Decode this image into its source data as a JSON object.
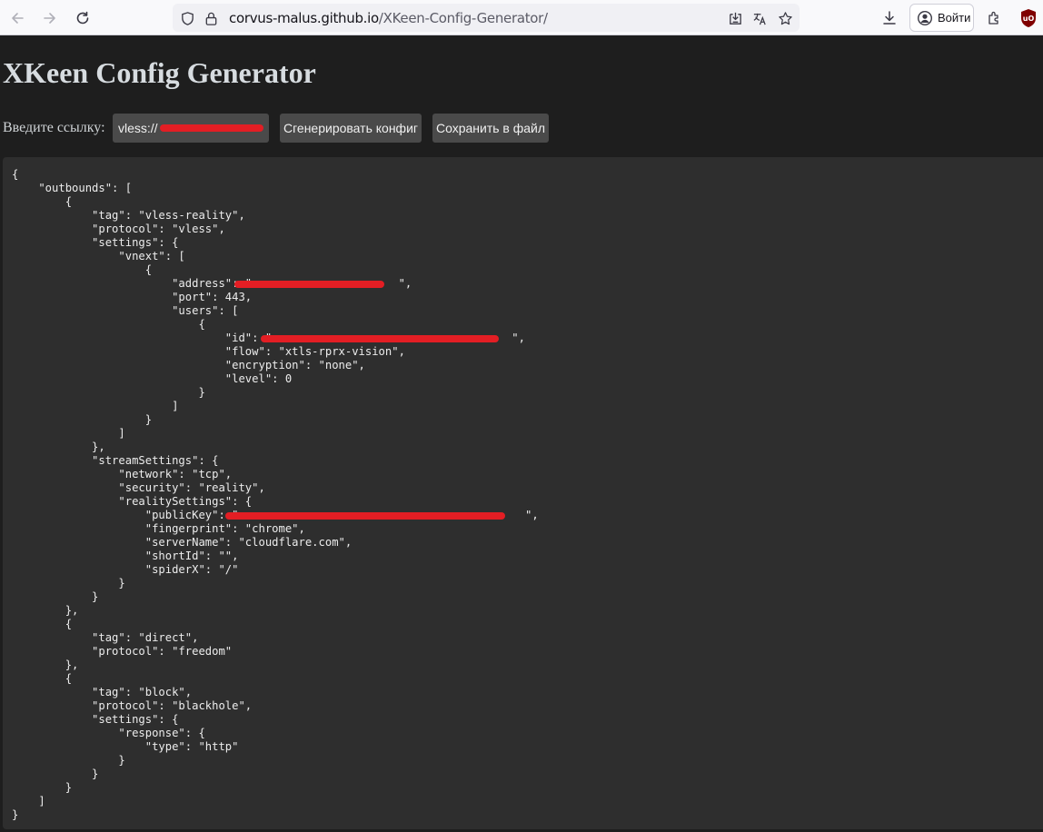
{
  "browser": {
    "url_host": "corvus-malus.github.io",
    "url_path": "/XKeen-Config-Generator/",
    "signin_label": "Войти"
  },
  "page": {
    "title": "XKeen Config Generator",
    "link_label": "Введите ссылку:",
    "link_value_prefix": "vless://",
    "generate_button": "Сгенерировать конфиг",
    "save_button": "Сохранить в файл"
  },
  "config_lines": [
    "{",
    "    \"outbounds\": [",
    "        {",
    "            \"tag\": \"vless-reality\",",
    "            \"protocol\": \"vless\",",
    "            \"settings\": {",
    "                \"vnext\": [",
    "                    {",
    "                        \"address\": \"                      \",",
    "                        \"port\": 443,",
    "                        \"users\": [",
    "                            {",
    "                                \"id\": \"                                    \",",
    "                                \"flow\": \"xtls-rprx-vision\",",
    "                                \"encryption\": \"none\",",
    "                                \"level\": 0",
    "                            }",
    "                        ]",
    "                    }",
    "                ]",
    "            },",
    "            \"streamSettings\": {",
    "                \"network\": \"tcp\",",
    "                \"security\": \"reality\",",
    "                \"realitySettings\": {",
    "                    \"publicKey\": \"                                           \",",
    "                    \"fingerprint\": \"chrome\",",
    "                    \"serverName\": \"cloudflare.com\",",
    "                    \"shortId\": \"\",",
    "                    \"spiderX\": \"/\"",
    "                }",
    "            }",
    "        },",
    "        {",
    "            \"tag\": \"direct\",",
    "            \"protocol\": \"freedom\"",
    "        },",
    "        {",
    "            \"tag\": \"block\",",
    "            \"protocol\": \"blackhole\",",
    "            \"settings\": {",
    "                \"response\": {",
    "                    \"type\": \"http\"",
    "                }",
    "            }",
    "        }",
    "    ]",
    "}"
  ],
  "colors": {
    "page_bg": "#1e1e1e",
    "panel_bg": "#2e2e2e",
    "button_bg": "#4a4a4a",
    "redaction": "#e31e24"
  }
}
